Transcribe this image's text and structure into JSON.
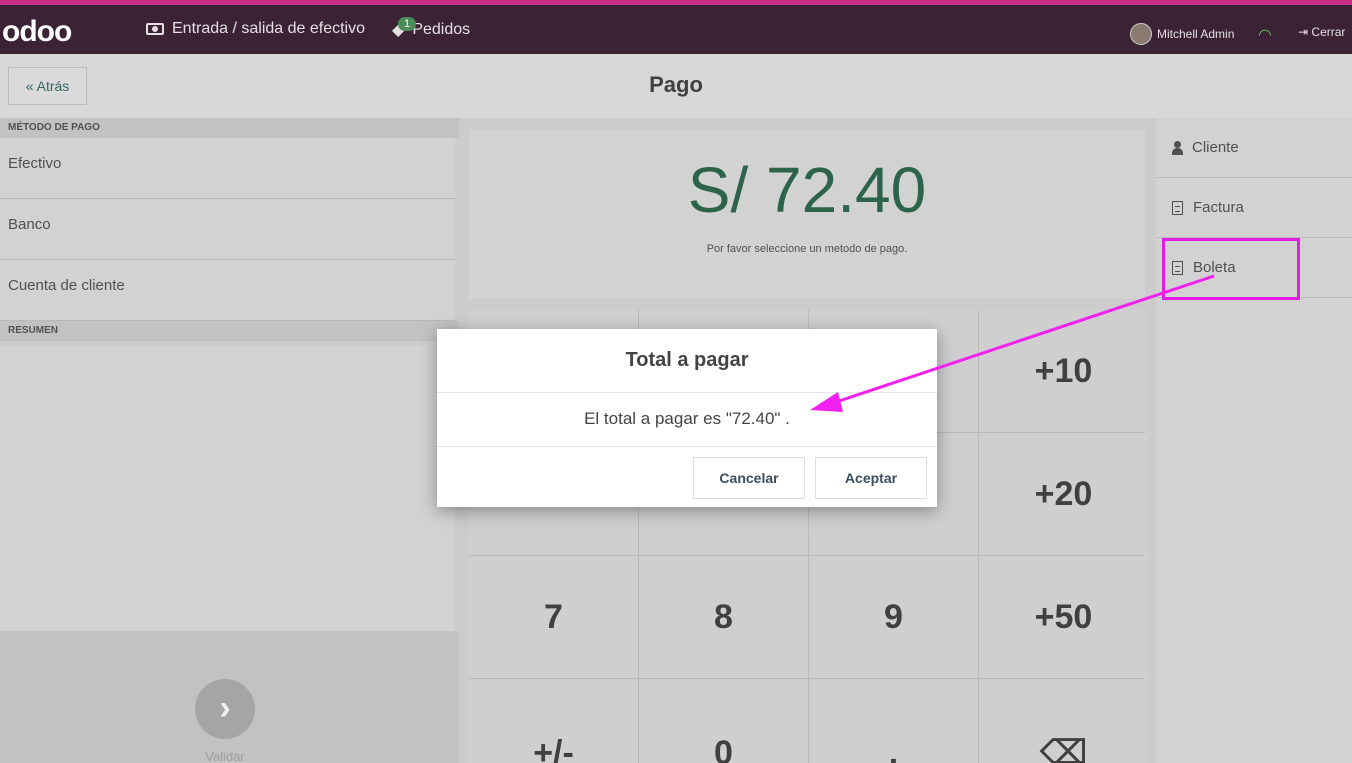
{
  "topbar": {
    "logo": "odoo",
    "cash_label": "Entrada / salida de efectivo",
    "orders_label": "Pedidos",
    "orders_badge": "1",
    "user": "Mitchell Admin",
    "close_label": "Cerrar"
  },
  "controlbar": {
    "back_label": "« Atrás",
    "title": "Pago"
  },
  "left": {
    "payment_section": "MÉTODO DE PAGO",
    "methods": [
      "Efectivo",
      "Banco",
      "Cuenta de cliente"
    ],
    "summary_section": "RESUMEN",
    "validate_icon": "chevron-right-icon",
    "validate_label": "Validar"
  },
  "center": {
    "amount": "S/ 72.40",
    "hint": "Por favor seleccione un metodo de pago.",
    "keys": [
      "+10",
      "+20",
      "7",
      "8",
      "9",
      "+50",
      "+/-",
      "0",
      ".",
      "⌫"
    ]
  },
  "right": {
    "customer": "Cliente",
    "invoice": "Factura",
    "receipt": "Boleta"
  },
  "modal": {
    "title": "Total a pagar",
    "body": "El total a pagar es \"72.40\" .",
    "cancel": "Cancelar",
    "accept": "Aceptar"
  },
  "colors": {
    "accent": "#f020f0",
    "topbar": "#3b2235",
    "amount": "#2e6b4f"
  }
}
